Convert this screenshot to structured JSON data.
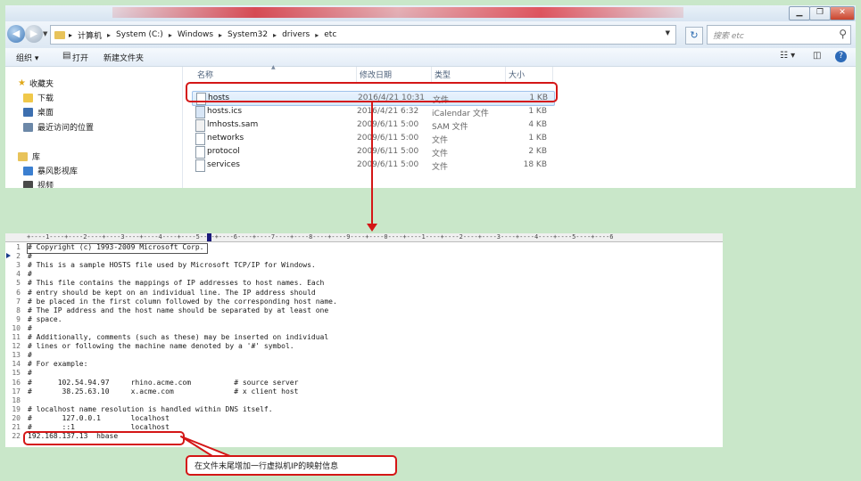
{
  "explorer": {
    "window_controls": [
      "▁",
      "❐",
      "✕"
    ],
    "breadcrumb": [
      "计算机",
      "System (C:)",
      "Windows",
      "System32",
      "drivers",
      "etc"
    ],
    "search_placeholder": "搜索 etc",
    "toolbar": {
      "organize": "组织",
      "open": "打开",
      "new_folder": "新建文件夹"
    },
    "sidebar": {
      "favorites_label": "收藏夹",
      "favorites": [
        "下载",
        "桌面",
        "最近访问的位置"
      ],
      "libraries_label": "库",
      "libraries": [
        "暴风影视库",
        "视频"
      ]
    },
    "columns": {
      "name": "名称",
      "date": "修改日期",
      "type": "类型",
      "size": "大小"
    },
    "files": [
      {
        "name": "hosts",
        "date": "2016/4/21 10:31",
        "type": "文件",
        "size": "1 KB",
        "icon": "file-icon"
      },
      {
        "name": "hosts.ics",
        "date": "2016/4/21 6:32",
        "type": "iCalendar 文件",
        "size": "1 KB",
        "icon": "calendar-file-icon"
      },
      {
        "name": "lmhosts.sam",
        "date": "2009/6/11 5:00",
        "type": "SAM 文件",
        "size": "4 KB",
        "icon": "sam-file-icon"
      },
      {
        "name": "networks",
        "date": "2009/6/11 5:00",
        "type": "文件",
        "size": "1 KB",
        "icon": "file-icon"
      },
      {
        "name": "protocol",
        "date": "2009/6/11 5:00",
        "type": "文件",
        "size": "2 KB",
        "icon": "file-icon"
      },
      {
        "name": "services",
        "date": "2009/6/11 5:00",
        "type": "文件",
        "size": "18 KB",
        "icon": "file-icon"
      }
    ]
  },
  "editor": {
    "ruler": "+----1----+----2----+----3----+----4----+----5----+----6----+----7----+----8----+----9----+----0----+----1----+----2----+----3----+----4----+----5----+----6",
    "lines": [
      "# Copyright (c) 1993-2009 Microsoft Corp.",
      "#",
      "# This is a sample HOSTS file used by Microsoft TCP/IP for Windows.",
      "#",
      "# This file contains the mappings of IP addresses to host names. Each",
      "# entry should be kept on an individual line. The IP address should",
      "# be placed in the first column followed by the corresponding host name.",
      "# The IP address and the host name should be separated by at least one",
      "# space.",
      "#",
      "# Additionally, comments (such as these) may be inserted on individual",
      "# lines or following the machine name denoted by a '#' symbol.",
      "#",
      "# For example:",
      "#",
      "#      102.54.94.97     rhino.acme.com          # source server",
      "#       38.25.63.10     x.acme.com              # x client host",
      "",
      "# localhost name resolution is handled within DNS itself.",
      "#\t127.0.0.1       localhost",
      "#\t::1             localhost",
      "192.168.137.13  hbase"
    ]
  },
  "annotation": {
    "callout_text": "在文件末尾增加一行虚拟机IP的映射信息"
  },
  "colors": {
    "highlight_red": "#d41616",
    "background": "#c9e7c9",
    "selection": "#d7e8fb"
  }
}
